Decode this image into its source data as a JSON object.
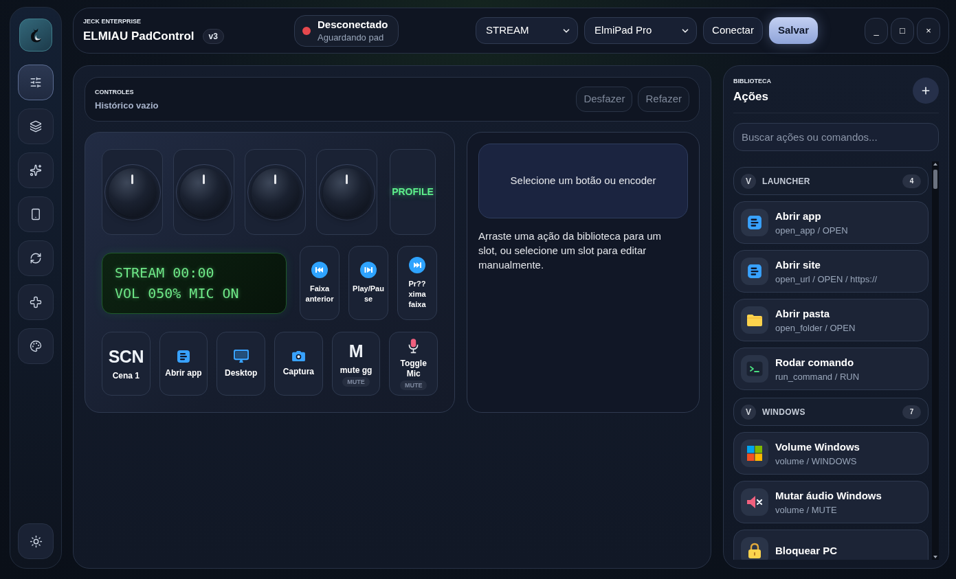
{
  "sidebar": {
    "items": [
      {
        "selected": true
      },
      {
        "selected": false
      },
      {
        "selected": false
      },
      {
        "selected": false
      },
      {
        "selected": false
      },
      {
        "selected": false
      },
      {
        "selected": false
      }
    ]
  },
  "header": {
    "company": "JECK ENTERPRISE",
    "title": "ELMIAU PadControl",
    "version": "v3",
    "status": {
      "title": "Desconectado",
      "subtitle": "Aguardando pad",
      "connected": false
    },
    "profile_select": {
      "value": "STREAM"
    },
    "device_select": {
      "value": "ElmiPad Pro"
    },
    "buttons": [
      {
        "label": "Conectar",
        "primary": false
      },
      {
        "label": "Salvar",
        "primary": true
      }
    ],
    "window_controls": [
      "_",
      "□",
      "×"
    ]
  },
  "controls": {
    "label": "CONTROLES",
    "history": "Histórico vazio",
    "buttons": [
      {
        "label": "Desfazer",
        "disabled": true
      },
      {
        "label": "Refazer",
        "disabled": true
      }
    ]
  },
  "device": {
    "top_row": [
      {
        "kind": "knob"
      },
      {
        "kind": "knob"
      },
      {
        "kind": "knob"
      },
      {
        "kind": "knob"
      },
      {
        "kind": "text",
        "label": "PROFILE"
      }
    ],
    "lcd": [
      "STREAM 00:00",
      "VOL 050% MIC ON"
    ],
    "media_buttons": [
      {
        "label": "Faixa anterior"
      },
      {
        "label": "Play/Pause"
      },
      {
        "label": "Pr??xima faixa"
      }
    ],
    "buttons": [
      {
        "glyph": "SCN",
        "label": "Cena 1"
      },
      {
        "label": "Abrir app"
      },
      {
        "label": "Desktop"
      },
      {
        "label": "Captura"
      },
      {
        "glyph": "M",
        "label": "mute gg",
        "badge": "MUTE"
      },
      {
        "label": "Toggle Mic",
        "badge": "MUTE"
      }
    ]
  },
  "inspector": {
    "placeholder": "Selecione um botão ou encoder",
    "hint": "Arraste uma ação da biblioteca para um slot, ou selecione um slot para editar manualmente."
  },
  "library": {
    "label": "BIBLIOTECA",
    "title": "Ações",
    "search": {
      "placeholder": "Buscar ações ou comandos..."
    },
    "groups": [
      {
        "toggle": "V",
        "name": "LAUNCHER",
        "count": "4",
        "items": [
          {
            "title": "Abrir app",
            "subtitle": "open_app / OPEN"
          },
          {
            "title": "Abrir site",
            "subtitle": "open_url / OPEN / https://"
          },
          {
            "title": "Abrir pasta",
            "subtitle": "open_folder / OPEN"
          },
          {
            "title": "Rodar comando",
            "subtitle": "run_command / RUN"
          }
        ]
      },
      {
        "toggle": "V",
        "name": "WINDOWS",
        "count": "7",
        "items": [
          {
            "title": "Volume Windows",
            "subtitle": "volume / WINDOWS"
          },
          {
            "title": "Mutar áudio Windows",
            "subtitle": "volume / MUTE"
          },
          {
            "title": "Bloquear PC"
          }
        ]
      }
    ]
  }
}
